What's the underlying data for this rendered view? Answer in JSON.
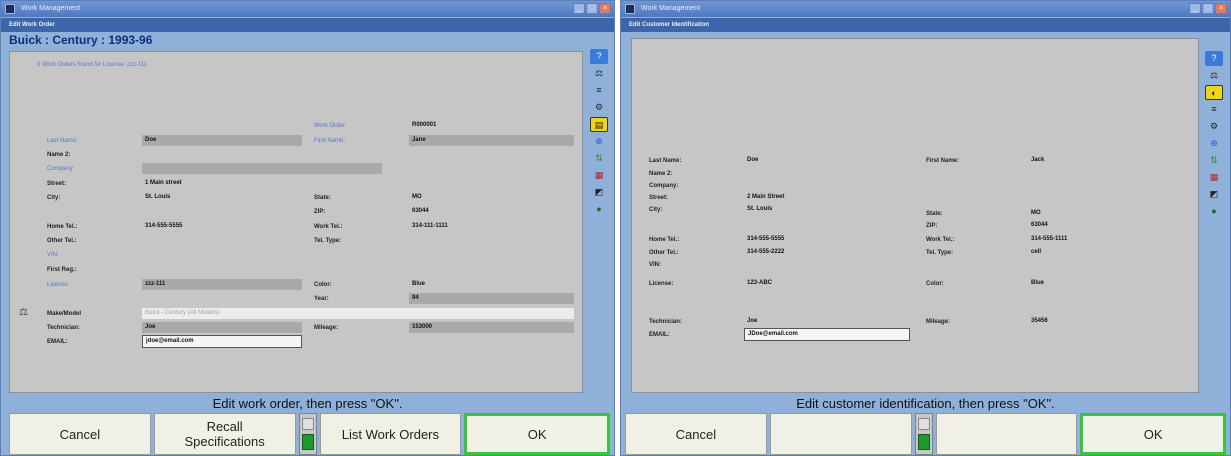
{
  "left": {
    "window_title": "Work Management",
    "subtitle": "Edit Work Order",
    "vehicle": "Buick : Century : 1993-96",
    "found_text": "0 Work Orders found for License: zzz-111",
    "fields": {
      "work_order_label": "Work Order:",
      "work_order": "R000001",
      "last_name_label": "Last Name:",
      "last_name": "Doe",
      "first_name_label": "First Name:",
      "first_name": "Jane",
      "name2_label": "Name 2:",
      "company_label": "Company:",
      "street_label": "Street:",
      "street": "1 Main street",
      "city_label": "City:",
      "city": "St. Louis",
      "state_label": "State:",
      "state": "MO",
      "zip_label": "ZIP:",
      "zip": "63044",
      "home_tel_label": "Home Tel.:",
      "home_tel": "314-555-5555",
      "work_tel_label": "Work Tel.:",
      "work_tel": "314-111-1111",
      "other_tel_label": "Other Tel.:",
      "tel_type_label": "Tel. Type:",
      "vin_label": "VIN:",
      "first_reg_label": "First Reg.:",
      "license_label": "License:",
      "license": "zzz-111",
      "color_label": "Color:",
      "color": "Blue",
      "year_label": "Year:",
      "year": "94",
      "make_model_label": "Make/Model",
      "make_model": "Buick - Century (All Models)",
      "technician_label": "Technician:",
      "technician": "Joe",
      "mileage_label": "Mileage:",
      "mileage": "153000",
      "email_label": "EMAIL:",
      "email": "jdoe@email.com"
    },
    "prompt": "Edit work order, then press \"OK\".",
    "buttons": {
      "cancel": "Cancel",
      "recall_1": "Recall",
      "recall_2": "Specifications",
      "list": "List Work Orders",
      "ok": "OK"
    }
  },
  "right": {
    "window_title": "Work Management",
    "subtitle": "Edit Customer Identification",
    "fields": {
      "last_name_label": "Last Name:",
      "last_name": "Doe",
      "first_name_label": "First Name:",
      "first_name": "Jack",
      "name2_label": "Name 2:",
      "company_label": "Company:",
      "street_label": "Street:",
      "street": "2 Main Street",
      "city_label": "City:",
      "city": "St. Louis",
      "state_label": "State:",
      "state": "MO",
      "zip_label": "ZIP:",
      "zip": "63044",
      "home_tel_label": "Home Tel.:",
      "home_tel": "314-555-5555",
      "work_tel_label": "Work Tel.:",
      "work_tel": "314-555-1111",
      "other_tel_label": "Other Tel.:",
      "other_tel": "314-555-2222",
      "tel_type_label": "Tel. Type:",
      "tel_type": "cell",
      "vin_label": "VIN:",
      "license_label": "License:",
      "license": "123-ABC",
      "color_label": "Color:",
      "color": "Blue",
      "technician_label": "Technician:",
      "technician": "Joe",
      "mileage_label": "Mileage:",
      "mileage": "35456",
      "email_label": "EMAIL:",
      "email": "JDoe@email.com"
    },
    "prompt": "Edit customer identification, then press \"OK\".",
    "buttons": {
      "cancel": "Cancel",
      "ok": "OK"
    }
  },
  "colors": {
    "window_bg": "#8fb1d9",
    "panel_bg": "#c6c6c6",
    "ok_border": "#3cc33c",
    "toggle_on": "#1f9a2e"
  }
}
